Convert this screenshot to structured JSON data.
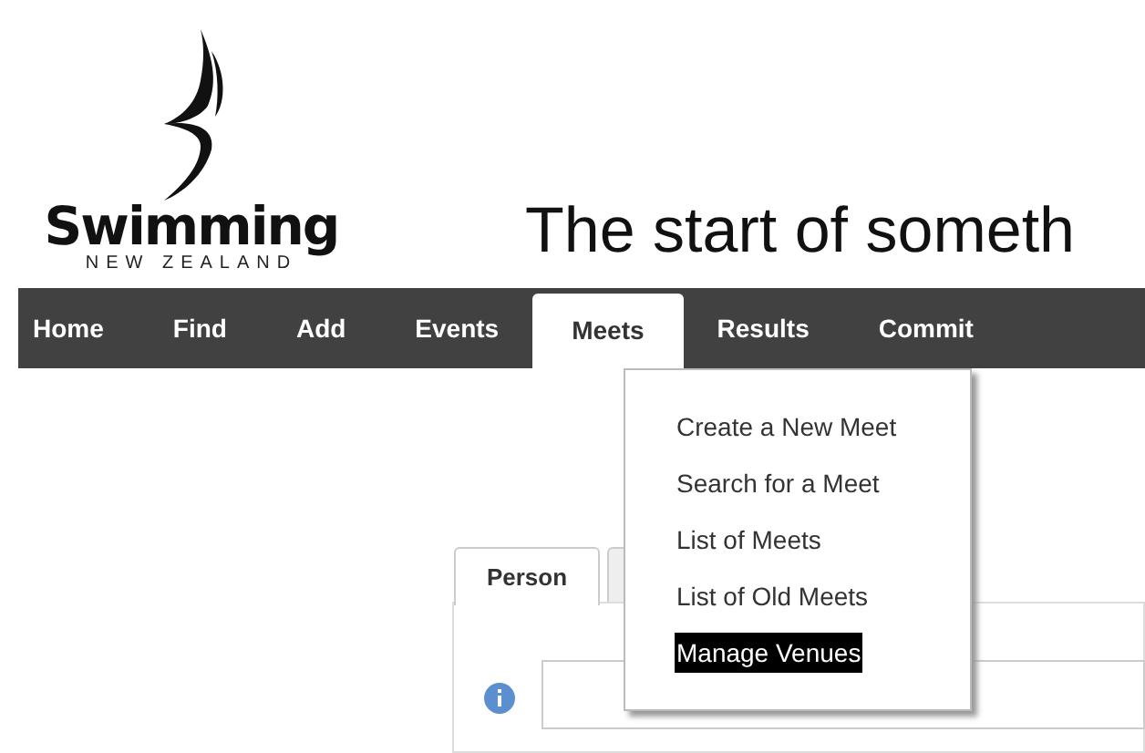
{
  "logo": {
    "name": "Swimming",
    "subtitle": "NEW ZEALAND"
  },
  "tagline": "The start of someth",
  "nav": [
    {
      "label": "Home",
      "selected": false
    },
    {
      "label": "Find",
      "selected": false
    },
    {
      "label": "Add",
      "selected": false
    },
    {
      "label": "Events",
      "selected": false
    },
    {
      "label": "Meets",
      "selected": true
    },
    {
      "label": "Results",
      "selected": false
    },
    {
      "label": "Commit",
      "selected": false
    }
  ],
  "dropdown": [
    {
      "label": "Create a New Meet",
      "selected": false
    },
    {
      "label": "Search for a Meet",
      "selected": false
    },
    {
      "label": "List of Meets",
      "selected": false
    },
    {
      "label": "List of Old Meets",
      "selected": false
    },
    {
      "label": "Manage Venues",
      "selected": true
    }
  ],
  "tabs": [
    {
      "label": "Person",
      "selected": true
    },
    {
      "selected": false
    }
  ]
}
